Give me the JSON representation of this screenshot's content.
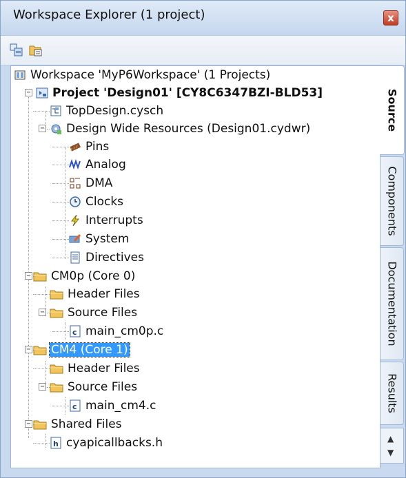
{
  "window": {
    "title": "Workspace Explorer (1 project)",
    "close_glyph": "x"
  },
  "toolbar": {
    "buttons": [
      {
        "icon": "collapse-all-icon"
      },
      {
        "icon": "show-files-icon"
      }
    ]
  },
  "tree": {
    "workspace": "Workspace 'MyP6Workspace' (1 Projects)",
    "project": "Project  'Design01' [CY8C6347BZI-BLD53]",
    "items": [
      {
        "label": "TopDesign.cysch",
        "icon": "schematic-icon"
      },
      {
        "label": "Design Wide Resources (Design01.cydwr)",
        "icon": "resources-icon"
      },
      {
        "label": "Pins",
        "icon": "pins-icon"
      },
      {
        "label": "Analog",
        "icon": "analog-icon"
      },
      {
        "label": "DMA",
        "icon": "dma-icon"
      },
      {
        "label": "Clocks",
        "icon": "clock-icon"
      },
      {
        "label": "Interrupts",
        "icon": "interrupt-icon"
      },
      {
        "label": "System",
        "icon": "system-icon"
      },
      {
        "label": "Directives",
        "icon": "directives-icon"
      },
      {
        "label": "CM0p (Core 0)",
        "icon": "folder-icon"
      },
      {
        "label": "Header Files",
        "icon": "folder-icon"
      },
      {
        "label": "Source Files",
        "icon": "folder-icon"
      },
      {
        "label": "main_cm0p.c",
        "icon": "c-file-icon"
      },
      {
        "label": "CM4 (Core 1)",
        "icon": "folder-icon",
        "selected": true
      },
      {
        "label": "Header Files",
        "icon": "folder-icon"
      },
      {
        "label": "Source Files",
        "icon": "folder-icon"
      },
      {
        "label": "main_cm4.c",
        "icon": "c-file-icon"
      },
      {
        "label": "Shared Files",
        "icon": "folder-icon"
      },
      {
        "label": "cyapicallbacks.h",
        "icon": "h-file-icon"
      }
    ]
  },
  "tabs": [
    "Source",
    "Components",
    "Documentation",
    "Results"
  ],
  "active_tab": "Source",
  "colors": {
    "selection": "#3399ff",
    "folder": "#f2c45a",
    "frame": "#c9daf0"
  }
}
